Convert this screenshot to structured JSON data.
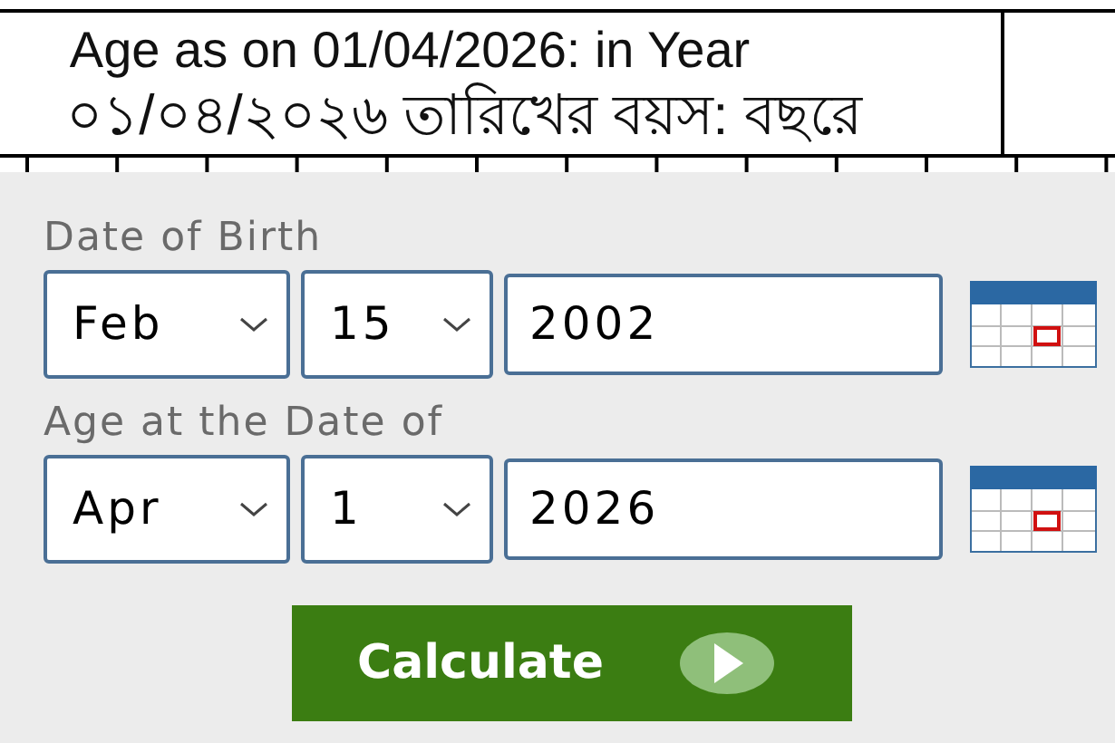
{
  "table_cell": {
    "lines": [
      "Age as on 01/04/2026: in Year",
      "০১/০৪/২০২৬ তারিখের বয়স: বছরে"
    ]
  },
  "date_rows": [
    {
      "label": "Date of Birth",
      "month": "Feb",
      "day": "15",
      "year": "2002"
    },
    {
      "label": "Age at the Date of",
      "month": "Apr",
      "day": "1",
      "year": "2026"
    }
  ],
  "button": {
    "label": "Calculate"
  }
}
